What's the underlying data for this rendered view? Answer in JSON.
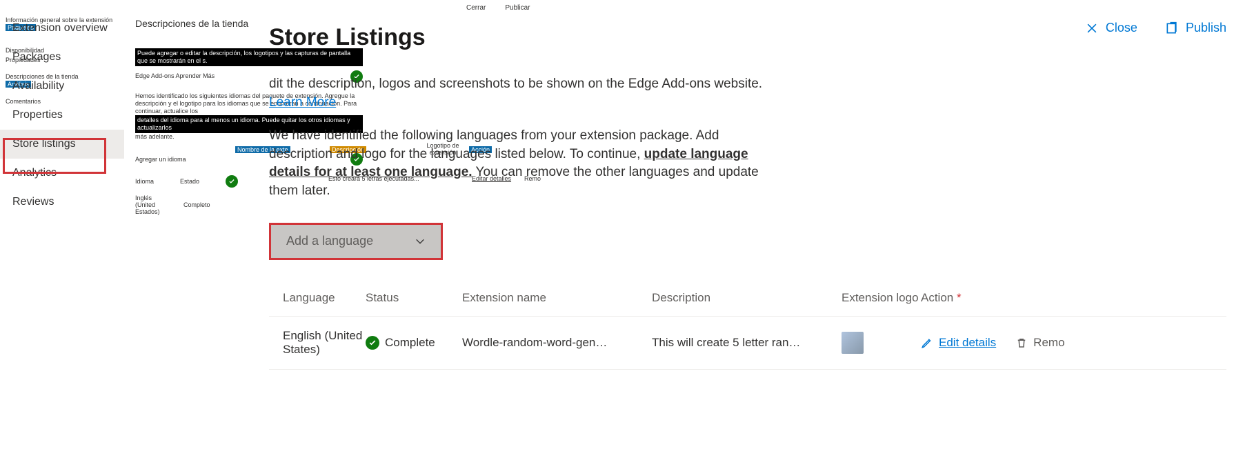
{
  "header": {
    "close": "Close",
    "publish": "Publish"
  },
  "sidebar": {
    "items": [
      "Extension overview",
      "Packages",
      "Availability",
      "Properties",
      "Store listings",
      "Analytics",
      "Reviews"
    ],
    "activeIndex": 4
  },
  "page": {
    "title": "Store Listings",
    "para1_prefix": "dit the description, logos and screenshots to be shown on the Edge Add-ons website. ",
    "learn_more": "Learn More",
    "para2_a": "We have identified the following languages from your extension package. Add description and logo for the languages listed below. To continue, ",
    "para2_bold": "update language details for at least one language.",
    "para2_b": " You can remove the other languages and update them later.",
    "add_language": "Add a language"
  },
  "table": {
    "headers": {
      "language": "Language",
      "status": "Status",
      "ext_name": "Extension name",
      "description": "Description",
      "ext_logo": "Extension logo",
      "action": "Action"
    },
    "rows": [
      {
        "language": "English (United States)",
        "status": "Complete",
        "ext_name": "Wordle-random-word-gen…",
        "description": "This will create 5 letter ran…",
        "edit": "Edit details",
        "remove": "Remo"
      }
    ]
  },
  "es": {
    "top_close": "Cerrar",
    "top_publish": "Publicar",
    "side": {
      "overview": "Información general sobre la extensión",
      "paquetes": "Paquetes",
      "disponibilidad": "Disponibilidad",
      "propiedades": "Propiedades",
      "descripciones": "Descripciones de la tienda",
      "analisis": "Análisis",
      "comentarios": "Comentarios"
    },
    "col": {
      "title": "Descripciones de la tienda",
      "bar1": "Puede agregar o editar la descripción, los logotipos y las capturas de pantalla que se mostrarán en el s.",
      "line_under_bar1": "Edge Add-ons  Aprender    Más",
      "p1": "Hemos identificado los siguientes idiomas del paquete de extensión. Agregue la descripción y el logotipo para los idiomas que se enumeran a continuación. Para continuar, actualice los",
      "bar2": "detalles del idioma para al menos un idioma. Puede quitar los otros idiomas y actualizarlos",
      "p1_tail": "más adelante.",
      "add": "Agregar un idioma",
      "th_lang": "Idioma",
      "th_status": "Estado",
      "tr_lang": "Inglés (United Estados)",
      "tr_status": "Completo"
    },
    "floats": {
      "nombre": "Nombre de la exte",
      "descripcion": "Descripción",
      "logotipo": "Logotipo de extensión",
      "accion": "Acción",
      "creara": "Esto creará 5 letras ejecutadas...",
      "editar": "Editar detalles",
      "remo": "Remo"
    }
  }
}
